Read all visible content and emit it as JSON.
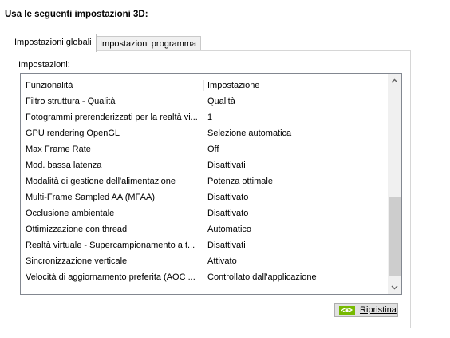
{
  "heading": "Usa le seguenti impostazioni 3D:",
  "tabs": [
    {
      "label": "Impostazioni globali",
      "active": true
    },
    {
      "label": "Impostazioni programma",
      "active": false
    }
  ],
  "settings_label": "Impostazioni:",
  "columns": {
    "feature": "Funzionalità",
    "setting": "Impostazione"
  },
  "rows": [
    {
      "feature": "Filtro struttura - Qualità",
      "setting": "Qualità"
    },
    {
      "feature": "Fotogrammi prerenderizzati per la realtà vi...",
      "setting": "1"
    },
    {
      "feature": "GPU rendering OpenGL",
      "setting": "Selezione automatica"
    },
    {
      "feature": "Max Frame Rate",
      "setting": "Off"
    },
    {
      "feature": "Mod. bassa latenza",
      "setting": "Disattivati"
    },
    {
      "feature": "Modalità di gestione dell'alimentazione",
      "setting": "Potenza ottimale"
    },
    {
      "feature": "Multi-Frame Sampled AA (MFAA)",
      "setting": "Disattivato"
    },
    {
      "feature": "Occlusione ambientale",
      "setting": "Disattivato"
    },
    {
      "feature": "Ottimizzazione con thread",
      "setting": "Automatico"
    },
    {
      "feature": "Realtà virtuale - Supercampionamento a t...",
      "setting": "Disattivati"
    },
    {
      "feature": "Sincronizzazione verticale",
      "setting": "Attivato"
    },
    {
      "feature": "Velocità di aggiornamento preferita (AOC ...",
      "setting": "Controllato dall'applicazione"
    }
  ],
  "restore_button": {
    "label": "Ripristina"
  },
  "colors": {
    "nvidia_green": "#76b900"
  }
}
